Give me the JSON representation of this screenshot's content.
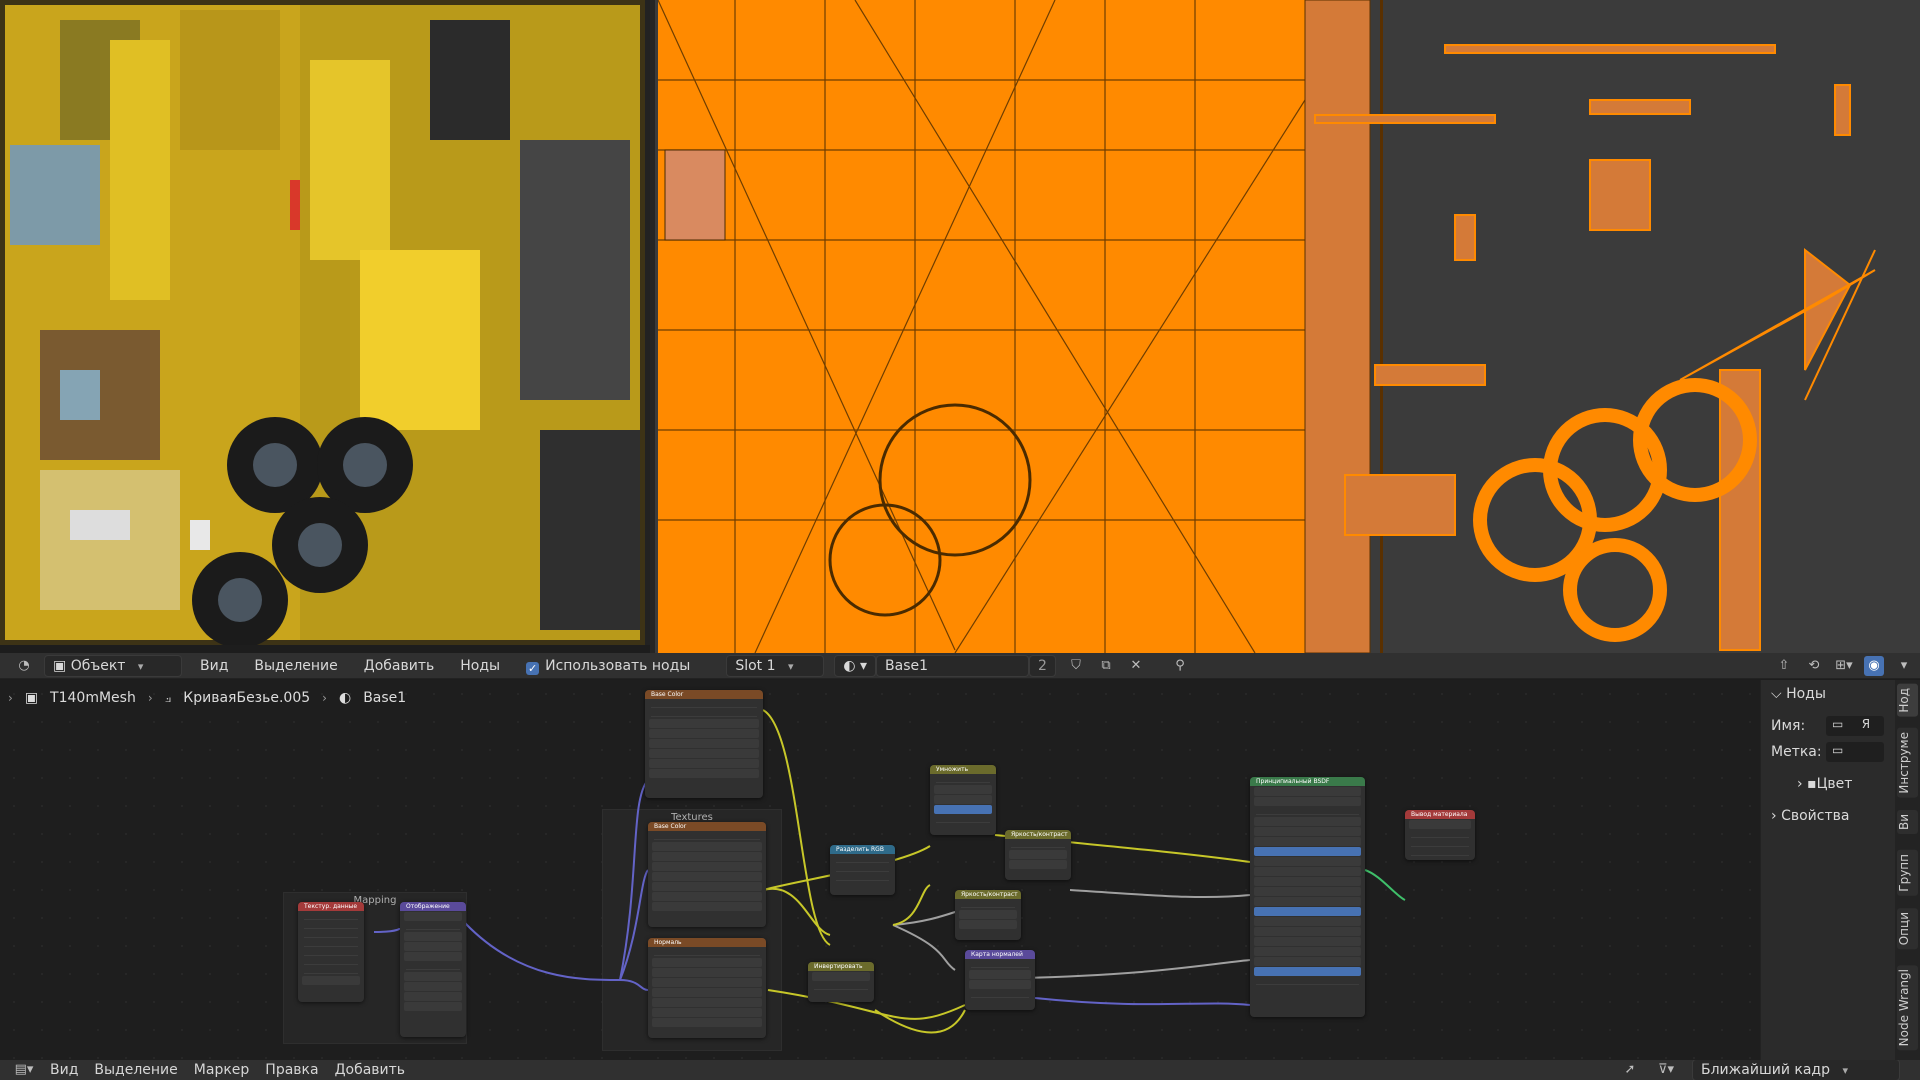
{
  "colors": {
    "uv_orange": "#ff8a00",
    "uv_dark": "#3b3b3b",
    "texture_yellow": "#d8b420",
    "accent_blue": "#4772b3"
  },
  "header": {
    "editor_type_icon": "node-editor-icon",
    "mode": "Объект",
    "menu": [
      "Вид",
      "Выделение",
      "Добавить",
      "Ноды"
    ],
    "use_nodes_label": "Использовать ноды",
    "use_nodes_checked": true,
    "slot": "Slot 1",
    "material_name": "Base1",
    "material_users": "2"
  },
  "breadcrumb": {
    "object": "T140mMesh",
    "curve": "КриваяБезье.005",
    "material": "Base1"
  },
  "frames": {
    "mapping": "Mapping",
    "textures": "Textures"
  },
  "nodes": {
    "base_color_top": "Base Color",
    "base_color_mid": "Base Color",
    "normal_tex": "Нормаль",
    "tex_coord": "Текстур. данные",
    "mapping": "Отображение",
    "multiply": "Умножить",
    "separate_rgb": "Разделить RGB",
    "bright_contrast_1": "Яркость/контраст",
    "bright_contrast_2": "Яркость/контраст",
    "invert": "Инвертировать",
    "normal_map": "Карта нормалей",
    "bsdf": "Принципиальный BSDF",
    "output": "Вывод материала"
  },
  "sidebar": {
    "panel_title": "Ноды",
    "name_label": "Имя:",
    "name_value": "Я",
    "label_label": "Метка:",
    "color_label": "Цвет",
    "properties_label": "Свойства",
    "tabs": [
      "Нод",
      "Инструме",
      "Ви",
      "Групп",
      "Опци",
      "Node Wrangl"
    ]
  },
  "bottom_header": {
    "menu": [
      "Вид",
      "Выделение",
      "Маркер",
      "Правка",
      "Добавить"
    ],
    "keyframe_interp": "Ближайший кадр"
  }
}
